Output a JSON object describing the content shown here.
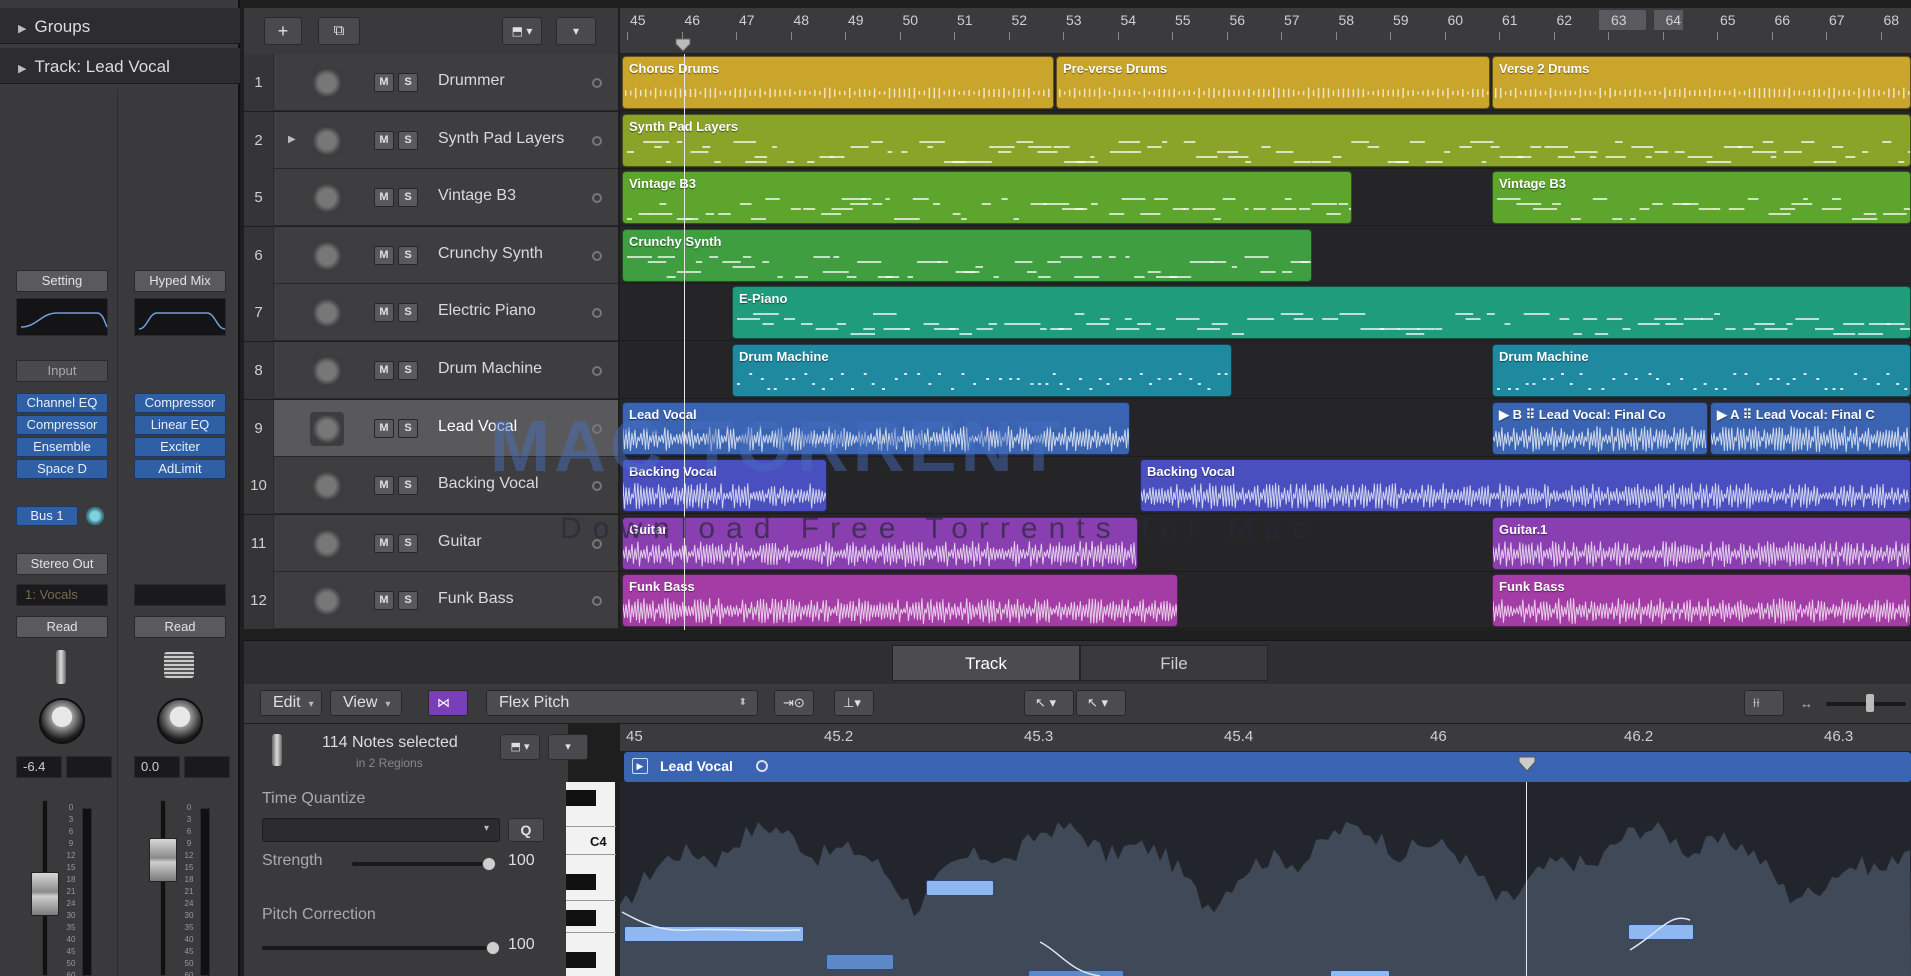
{
  "inspector": {
    "groups_label": "Groups",
    "track_label": "Track:  Lead Vocal",
    "strip1": {
      "setting": "Setting",
      "input": "Input",
      "plugins": [
        "Channel EQ",
        "Compressor",
        "Ensemble",
        "Space D"
      ],
      "send": "Bus 1",
      "output": "Stereo Out",
      "group": "1: Vocals",
      "automation": "Read",
      "volume": "-6.4"
    },
    "strip2": {
      "setting": "Hyped Mix",
      "plugins": [
        "Compressor",
        "Linear EQ",
        "Exciter",
        "AdLimit"
      ],
      "automation": "Read",
      "volume": "0.0"
    },
    "scale": [
      "0",
      "3",
      "6",
      "9",
      "12",
      "15",
      "18",
      "21",
      "24",
      "30",
      "35",
      "40",
      "45",
      "50",
      "60"
    ]
  },
  "toolbar": {
    "add": "+",
    "duplicate": "⧉"
  },
  "ruler": {
    "bars": [
      "45",
      "46",
      "47",
      "48",
      "49",
      "50",
      "51",
      "52",
      "53",
      "54",
      "55",
      "56",
      "57",
      "58",
      "59",
      "60",
      "61",
      "62",
      "63",
      "64",
      "65",
      "66",
      "67",
      "68"
    ]
  },
  "tracks": [
    {
      "num": "1",
      "name": "Drummer",
      "m": "M",
      "s": "S",
      "icon": "drum-kit-icon"
    },
    {
      "num": "2",
      "name": "Synth Pad Layers",
      "m": "M",
      "s": "S",
      "icon": "keyboard-stand-icon"
    },
    {
      "num": "5",
      "name": "Vintage B3",
      "m": "M",
      "s": "S",
      "icon": "organ-icon"
    },
    {
      "num": "6",
      "name": "Crunchy Synth",
      "m": "M",
      "s": "S",
      "icon": "synth-stand-icon"
    },
    {
      "num": "7",
      "name": "Electric Piano",
      "m": "M",
      "s": "S",
      "icon": "electric-piano-icon"
    },
    {
      "num": "8",
      "name": "Drum Machine",
      "m": "M",
      "s": "S",
      "icon": "drum-machine-icon"
    },
    {
      "num": "9",
      "name": "Lead Vocal",
      "m": "M",
      "s": "S",
      "icon": "microphone-icon"
    },
    {
      "num": "10",
      "name": "Backing Vocal",
      "m": "M",
      "s": "S",
      "icon": "microphone-icon"
    },
    {
      "num": "11",
      "name": "Guitar",
      "m": "M",
      "s": "S",
      "icon": "amp-icon"
    },
    {
      "num": "12",
      "name": "Funk Bass",
      "m": "M",
      "s": "S",
      "icon": "bass-amp-icon"
    }
  ],
  "regions": {
    "chorus_drums": "Chorus Drums",
    "preverse_drums": "Pre-verse Drums",
    "verse2_drums": "Verse 2 Drums",
    "synth_pad": "Synth Pad Layers",
    "vintage_b3_a": "Vintage B3",
    "vintage_b3_b": "Vintage B3",
    "crunchy": "Crunchy Synth",
    "epiano": "E-Piano",
    "drum_machine_a": "Drum Machine",
    "drum_machine_b": "Drum Machine",
    "lead_vocal": "Lead Vocal",
    "lead_comp_b": "▶  B  ⠿  Lead Vocal: Final Co",
    "lead_comp_a": "▶  A  ⠿  Lead Vocal: Final C",
    "backing_a": "Backing Vocal",
    "backing_b": "Backing Vocal",
    "guitar_a": "Guitar",
    "guitar_b": "Guitar.1",
    "bass_a": "Funk Bass",
    "bass_b": "Funk Bass"
  },
  "watermark": {
    "title": "MAC TORRENT",
    "subtitle": "Download Free Torrents for Mac"
  },
  "tabs": {
    "track": "Track",
    "file": "File"
  },
  "editor": {
    "edit": "Edit",
    "view": "View",
    "mode": "Flex Pitch",
    "notes_selected": "114 Notes selected",
    "regions_info": "in 2 Regions",
    "time_quantize": "Time Quantize",
    "q": "Q",
    "strength_label": "Strength",
    "strength_value": "100",
    "pitch_correction": "Pitch Correction",
    "pitch_value": "100",
    "c4": "C4",
    "ruler": [
      "45",
      "45.2",
      "45.3",
      "45.4",
      "46",
      "46.2",
      "46.3"
    ],
    "region_name": "Lead Vocal"
  },
  "colors": {
    "drummer": "#c9a52c",
    "synth_pad": "#8aa42a",
    "vintage": "#5ea52e",
    "crunchy": "#3f9e3f",
    "epiano": "#1f9c7c",
    "drum_machine": "#1f89a0",
    "lead_vocal": "#3a64b2",
    "backing": "#4a4fc0",
    "guitar": "#8a3fb0",
    "bass": "#a43ca5"
  }
}
